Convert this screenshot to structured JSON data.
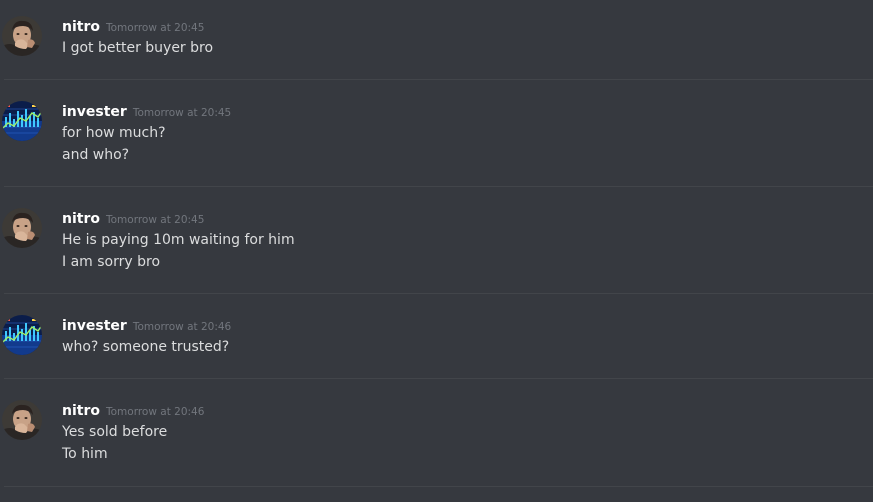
{
  "messages": [
    {
      "author": "nitro",
      "avatar": "nitro-avatar-icon",
      "timestamp": "Tomorrow at 20:45",
      "lines": [
        "I got better buyer bro"
      ]
    },
    {
      "author": "invester",
      "avatar": "invester-avatar-icon",
      "timestamp": "Tomorrow at 20:45",
      "lines": [
        "for how much?",
        "and who?"
      ]
    },
    {
      "author": "nitro",
      "avatar": "nitro-avatar-icon",
      "timestamp": "Tomorrow at 20:45",
      "lines": [
        "He is paying 10m waiting for him",
        "I am sorry bro"
      ]
    },
    {
      "author": "invester",
      "avatar": "invester-avatar-icon",
      "timestamp": "Tomorrow at 20:46",
      "lines": [
        "who? someone trusted?"
      ]
    },
    {
      "author": "nitro",
      "avatar": "nitro-avatar-icon",
      "timestamp": "Tomorrow at 20:46",
      "lines": [
        "Yes sold before",
        "To him"
      ]
    }
  ],
  "colors": {
    "background": "#36393f",
    "username": "#ffffff",
    "timestamp": "#72767d",
    "message_text": "#dcddde",
    "divider": "#42454a"
  }
}
